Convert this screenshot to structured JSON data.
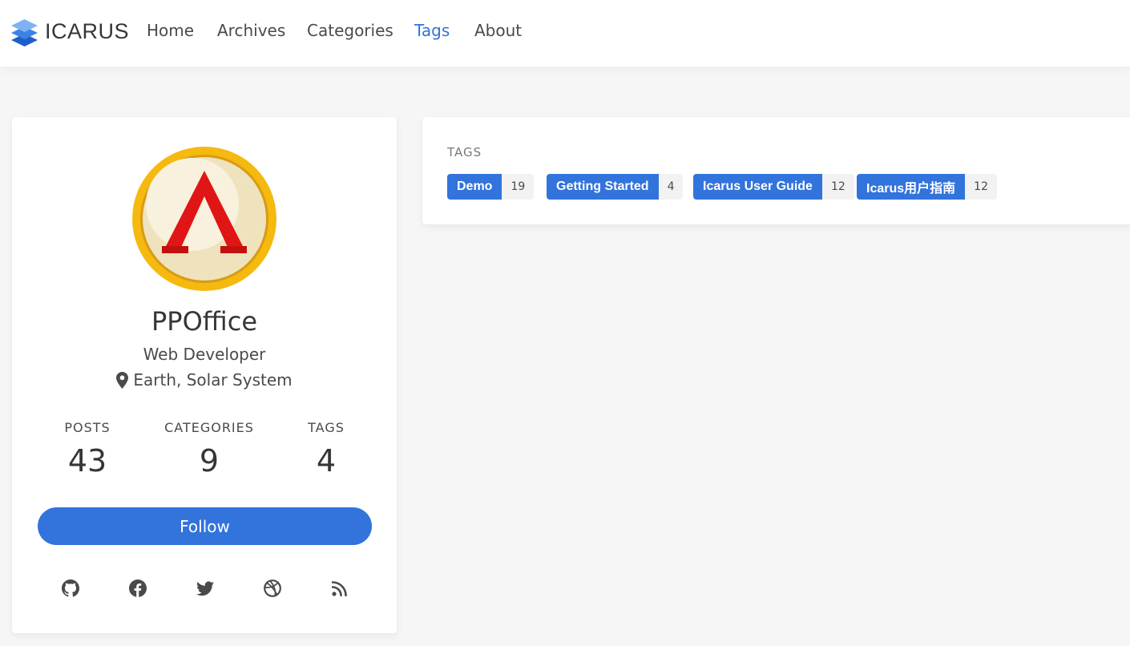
{
  "brand": {
    "name": "ICARUS",
    "logo_icon": "stacked-layers-icon"
  },
  "nav": {
    "items": [
      {
        "label": "Home",
        "active": false
      },
      {
        "label": "Archives",
        "active": false
      },
      {
        "label": "Categories",
        "active": false
      },
      {
        "label": "Tags",
        "active": true
      },
      {
        "label": "About",
        "active": false
      }
    ]
  },
  "profile": {
    "name": "PPOffice",
    "role": "Web Developer",
    "location": "Earth, Solar System",
    "location_icon": "map-marker-icon",
    "stats": [
      {
        "label": "POSTS",
        "value": "43"
      },
      {
        "label": "CATEGORIES",
        "value": "9"
      },
      {
        "label": "TAGS",
        "value": "4"
      }
    ],
    "follow_label": "Follow",
    "social_icons": [
      "github-icon",
      "facebook-icon",
      "twitter-icon",
      "dribbble-icon",
      "rss-icon"
    ]
  },
  "tags_widget": {
    "title": "TAGS",
    "tags": [
      {
        "name": "Demo",
        "count": "19"
      },
      {
        "name": "Getting Started",
        "count": "4"
      },
      {
        "name": "Icarus User Guide",
        "count": "12"
      },
      {
        "name": "Icarus用户指南",
        "count": "12"
      }
    ]
  },
  "colors": {
    "accent": "#3273dc",
    "background": "#f6f6f6",
    "text": "#363636"
  }
}
